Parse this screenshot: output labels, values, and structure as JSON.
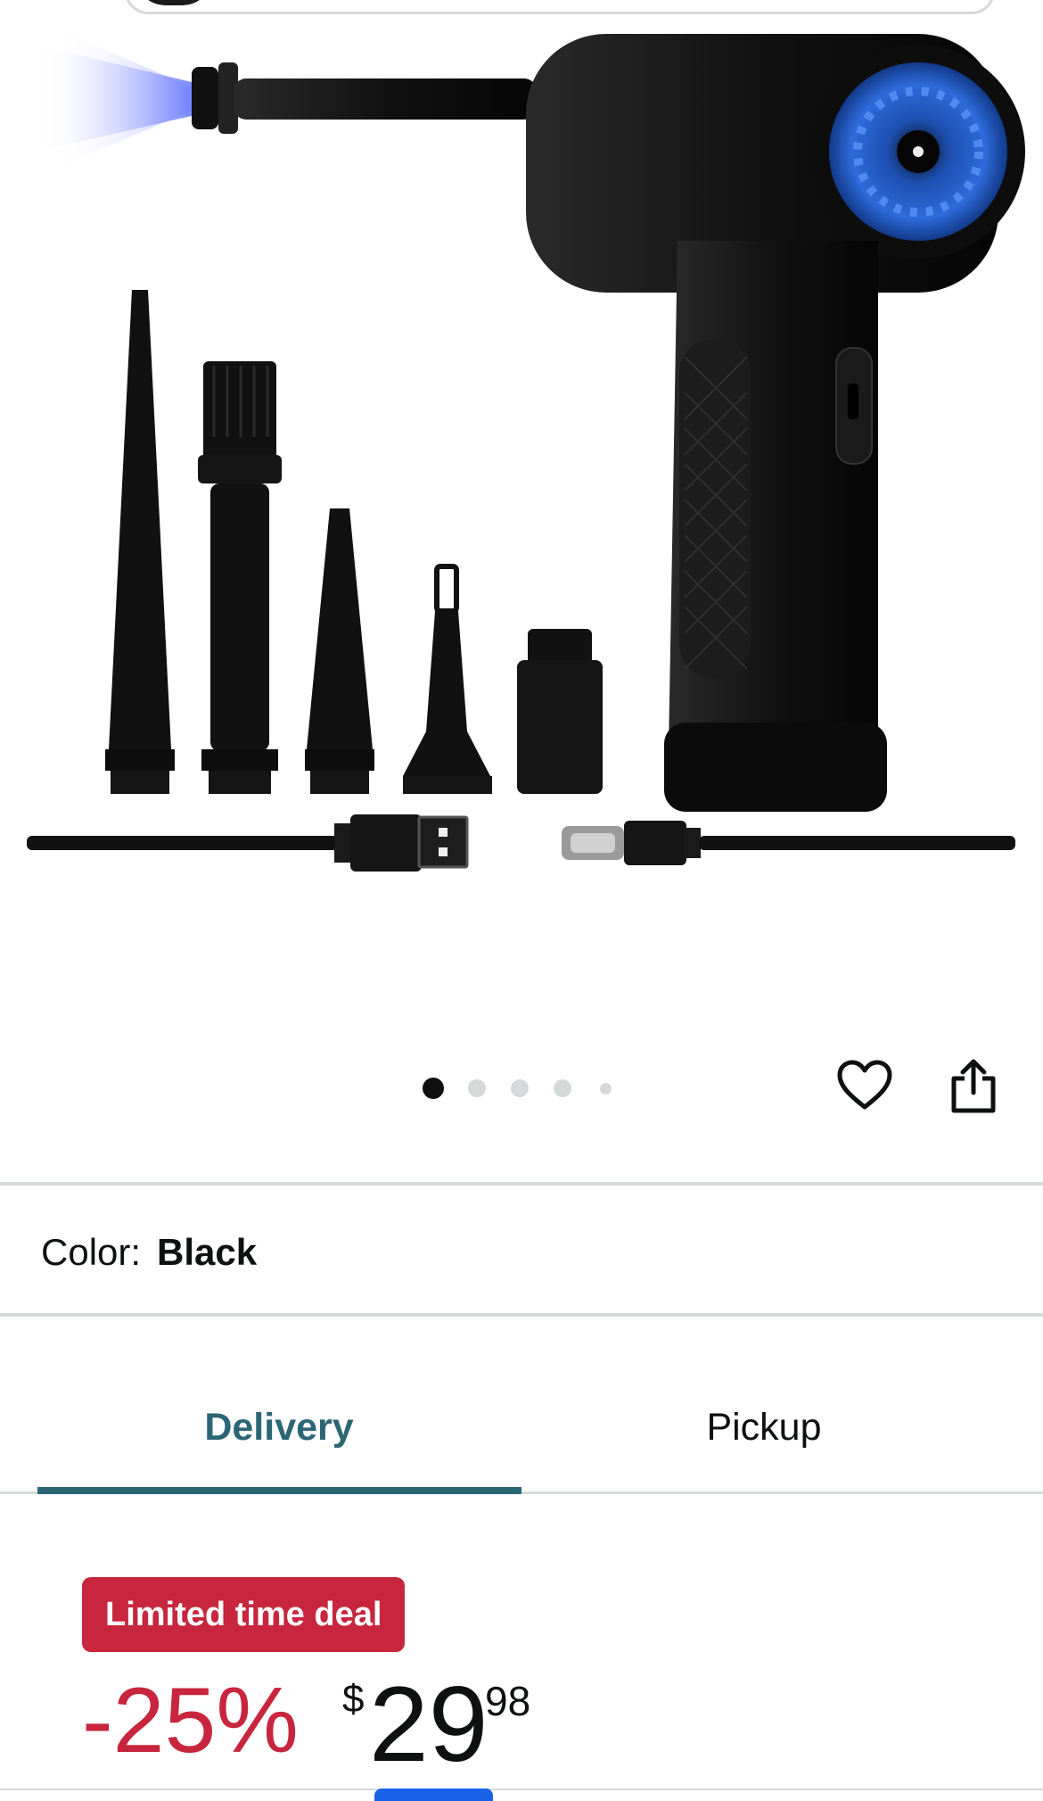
{
  "product": {
    "image_alt": "Black cordless compressed air duster with five nozzle attachments and a USB cable",
    "carousel": {
      "count": 5,
      "active_index": 0
    }
  },
  "actions": {
    "wishlist_icon": "heart-icon",
    "share_icon": "share-icon"
  },
  "variant": {
    "label": "Color:",
    "value": "Black"
  },
  "fulfillment_tabs": [
    {
      "label": "Delivery",
      "selected": true
    },
    {
      "label": "Pickup",
      "selected": false
    }
  ],
  "deal": {
    "badge": "Limited time deal",
    "discount": "-25%",
    "currency": "$",
    "price_whole": "29",
    "price_fraction": "98"
  },
  "colors": {
    "accent_teal": "#2b6674",
    "deal_red": "#c7263e",
    "divider": "#d5d9d9"
  }
}
